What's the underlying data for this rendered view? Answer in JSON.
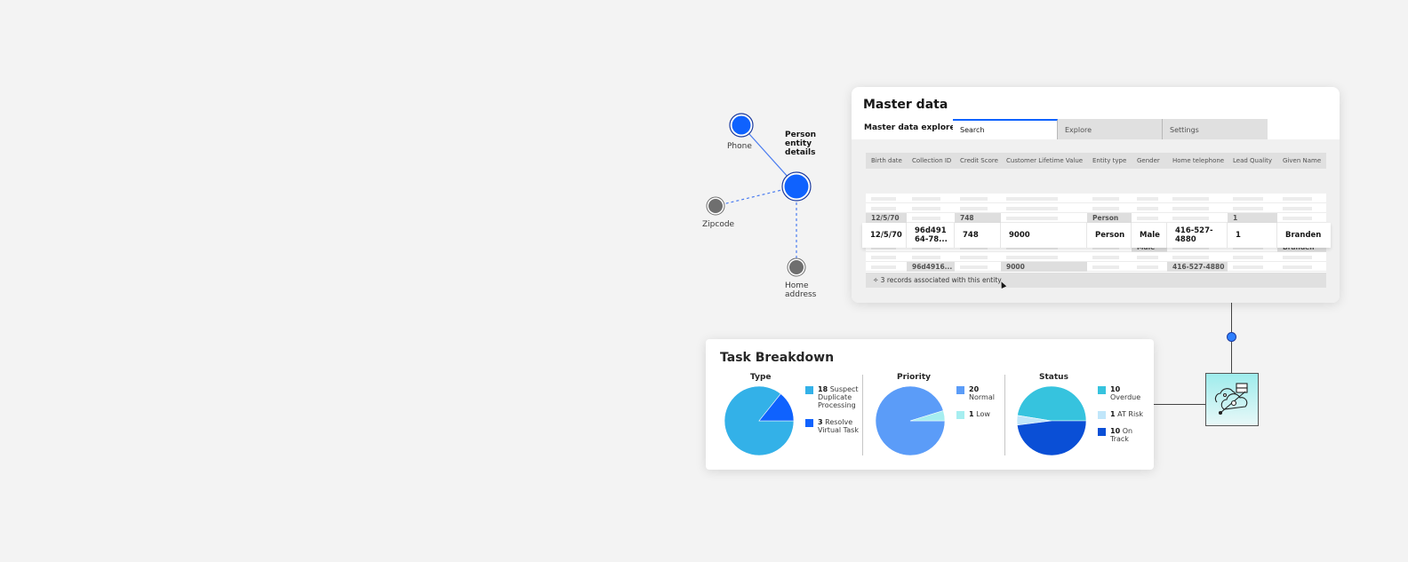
{
  "graph": {
    "center_label": "Person entity details",
    "nodes": [
      {
        "label": "Phone"
      },
      {
        "label": "Zipcode"
      },
      {
        "label": "Home address"
      }
    ]
  },
  "master": {
    "title": "Master data",
    "subtitle": "Master data explorer",
    "tabs": [
      {
        "label": "Search",
        "active": true
      },
      {
        "label": "Explore"
      },
      {
        "label": "Settings"
      }
    ],
    "columns": [
      "Birth date",
      "Collection ID",
      "Credit Score",
      "Customer Lifetime Value",
      "Entity type",
      "Gender",
      "Home telephone",
      "Lead Quality",
      "Given Name"
    ],
    "hero_row": [
      "12/5/70",
      "96d491 64-78...",
      "748",
      "9000",
      "Person",
      "Male",
      "416-527-4880",
      "1",
      "Branden"
    ],
    "highlight_rows": [
      [
        "12/5/70",
        "",
        "748",
        "",
        "Person",
        "",
        "",
        "1",
        ""
      ],
      [
        "",
        "",
        "",
        "",
        "",
        "Male",
        "",
        "",
        "Branden"
      ],
      [
        "",
        "96d4916...",
        "",
        "9000",
        "",
        "",
        "416-527-4880",
        "",
        ""
      ]
    ],
    "footer_text": "3 records associated with this entity",
    "footer_icon": "records-icon"
  },
  "task": {
    "title": "Task Breakdown",
    "pies": [
      {
        "title": "Type",
        "slices": [
          {
            "count": "18",
            "label": "Suspect Duplicate Processing",
            "color": "#33b1e8"
          },
          {
            "count": "3",
            "label": "Resolve Virtual Task",
            "color": "#0f62fe"
          }
        ]
      },
      {
        "title": "Priority",
        "slices": [
          {
            "count": "20",
            "label": "Normal",
            "color": "#5b9cf8"
          },
          {
            "count": "1",
            "label": "Low",
            "color": "#a6eef0"
          }
        ]
      },
      {
        "title": "Status",
        "slices": [
          {
            "count": "10",
            "label": "Overdue",
            "color": "#36c3de"
          },
          {
            "count": "1",
            "label": "AT Risk",
            "color": "#c0e6fa"
          },
          {
            "count": "10",
            "label": "On Track",
            "color": "#0a4fd6"
          }
        ]
      }
    ]
  },
  "chart_data": [
    {
      "type": "pie",
      "title": "Type",
      "categories": [
        "Suspect Duplicate Processing",
        "Resolve Virtual Task"
      ],
      "values": [
        18,
        3
      ]
    },
    {
      "type": "pie",
      "title": "Priority",
      "categories": [
        "Normal",
        "Low"
      ],
      "values": [
        20,
        1
      ]
    },
    {
      "type": "pie",
      "title": "Status",
      "categories": [
        "Overdue",
        "AT Risk",
        "On Track"
      ],
      "values": [
        10,
        1,
        10
      ]
    }
  ],
  "integration": {
    "icon": "cloud-integration-icon",
    "accent": "#9eecec"
  }
}
